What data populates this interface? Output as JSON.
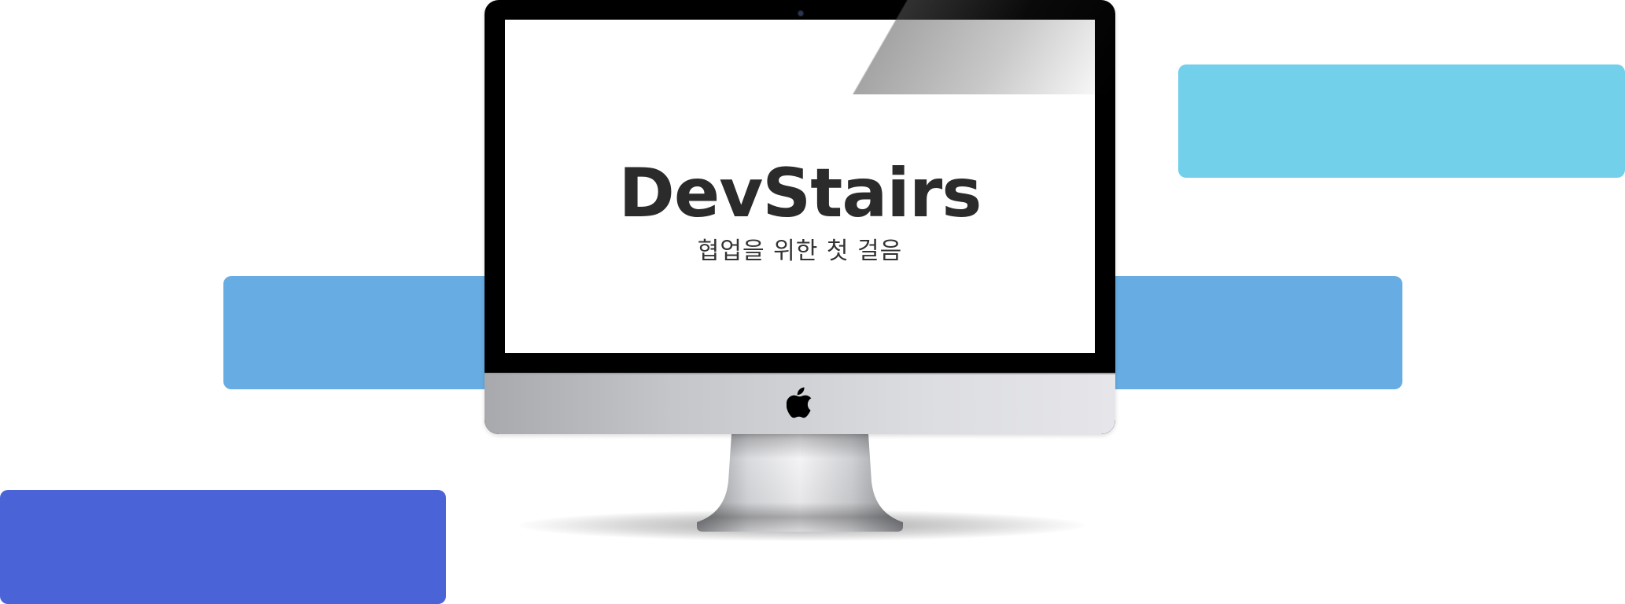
{
  "colors": {
    "cyan_bar": "#72d0eb",
    "blue_bar": "#67ade3",
    "indigo_bar": "#4a64d8",
    "screen_bg": "#ffffff",
    "title_text": "#2b2b2b"
  },
  "screen": {
    "title": "DevStairs",
    "subtitle": "협업을 위한 첫 걸음"
  },
  "icons": {
    "logo": "apple-logo-icon",
    "camera": "camera-icon"
  }
}
